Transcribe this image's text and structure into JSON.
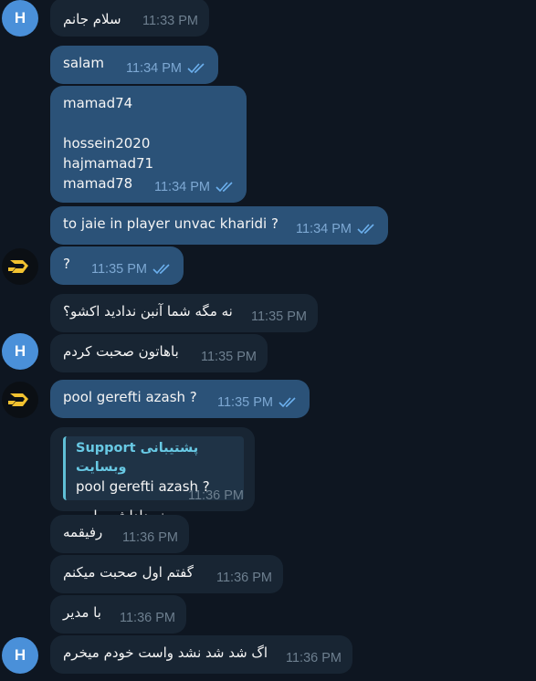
{
  "messages": [
    {
      "text": "سلام جانم",
      "time": "11:33 PM"
    },
    {
      "text": "salam",
      "time": "11:34 PM"
    },
    {
      "text": "mamad74\n\nhossein2020\nhajmamad71\nmamad78",
      "time": "11:34 PM"
    },
    {
      "text": "to jaie in player unvac kharidi ?",
      "time": "11:34 PM"
    },
    {
      "text": "?",
      "time": "11:35 PM"
    },
    {
      "text": "نه مگه شما آنبن ندادید اکشو؟",
      "time": "11:35 PM"
    },
    {
      "text": "باهاتون صحبت کردم",
      "time": "11:35 PM"
    },
    {
      "text": "pool gerefti azash ?",
      "time": "11:35 PM"
    },
    {
      "text": "نه داداش پول چیه",
      "time": "11:36 PM",
      "reply": {
        "name": "Support پشتیبانی وبسایت",
        "text": "pool gerefti azash ?"
      }
    },
    {
      "text": "رفیقمه",
      "time": "11:36 PM"
    },
    {
      "text": "گفتم اول صحبت میکنم",
      "time": "11:36 PM"
    },
    {
      "text": "با مدیر",
      "time": "11:36 PM"
    },
    {
      "text": "اگ شد شد نشد واست خودم میخرم",
      "time": "11:36 PM"
    }
  ],
  "avatars": {
    "h_letter": "H"
  },
  "colors": {
    "background": "#0e1621",
    "incoming": "#182533",
    "outgoing": "#2b5278",
    "avatar": "#4a90d9"
  }
}
